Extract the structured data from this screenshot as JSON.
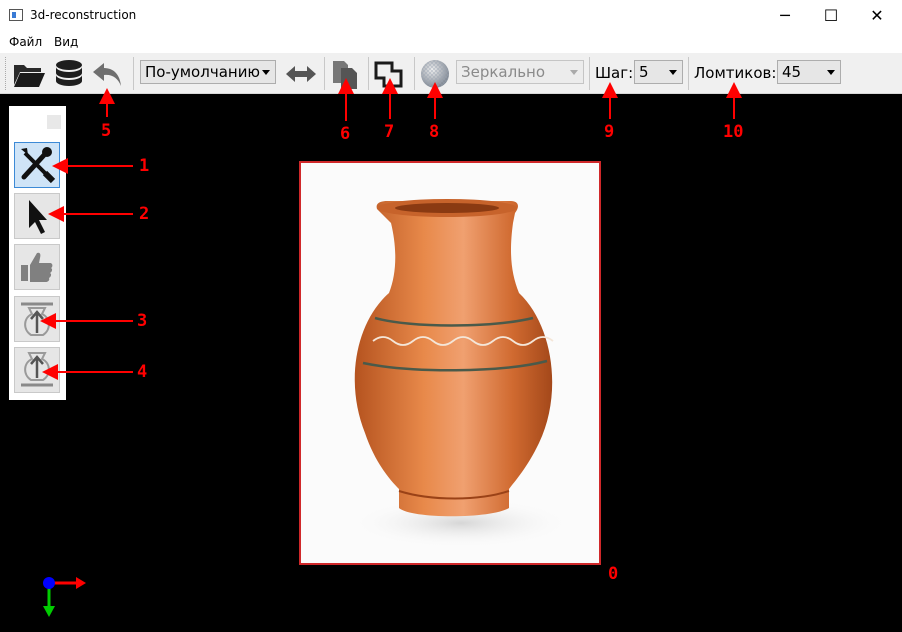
{
  "window": {
    "title": "3d-reconstruction",
    "minimize_glyph": "─",
    "maximize_glyph": "☐",
    "close_glyph": "✕"
  },
  "menu": {
    "items": [
      {
        "label": "Файл"
      },
      {
        "label": "Вид"
      }
    ]
  },
  "toolbar": {
    "open_icon": "folder-open-icon",
    "database_icon": "database-icon",
    "undo_icon": "undo-icon",
    "mode_select": "По-умолчанию",
    "swap_icon": "swap-horizontal-icon",
    "copy_icon": "copy-pages-icon",
    "crop_icon": "polygon-outline-icon",
    "sphere_icon": "sphere-texture-icon",
    "mirror_select": "Зеркально",
    "step_label": "Шаг:",
    "step_value": "5",
    "slices_label": "Ломтиков:",
    "slices_value": "45"
  },
  "tool_panel": {
    "buttons": [
      {
        "icon": "wrench-screwdriver-icon",
        "active": true
      },
      {
        "icon": "cursor-arrow-icon",
        "active": false
      },
      {
        "icon": "thumbs-up-icon",
        "active": false
      },
      {
        "icon": "vase-top-arrow-icon",
        "active": false
      },
      {
        "icon": "vase-bottom-arrow-icon",
        "active": false
      }
    ]
  },
  "annotations": {
    "labels": [
      "1",
      "2",
      "3",
      "4",
      "5",
      "6",
      "7",
      "8",
      "9",
      "10",
      "0"
    ]
  },
  "colors": {
    "annotation": "#ff0000",
    "frame": "#d0282a",
    "axis_x": "#ff0000",
    "axis_y": "#00cc00",
    "axis_origin": "#0000ff",
    "vase": "#e07a3c"
  }
}
